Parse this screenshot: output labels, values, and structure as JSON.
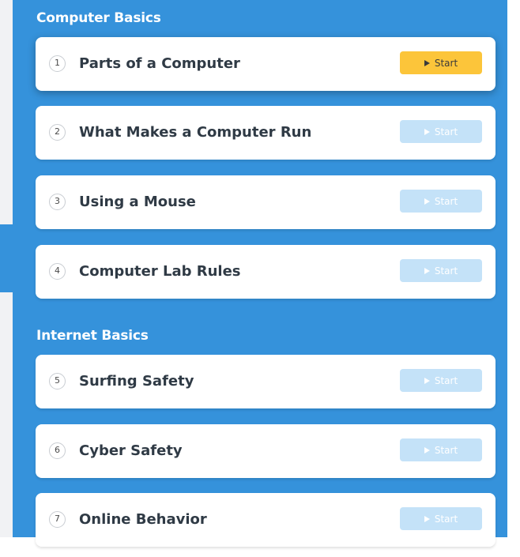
{
  "colors": {
    "panel_background": "#3592db",
    "card_background": "#ffffff",
    "start_active": "#fcc53a",
    "start_inactive": "#c4e2f8"
  },
  "sections": [
    {
      "title": "Computer Basics",
      "lessons": [
        {
          "number": "1",
          "title": "Parts of a Computer",
          "start_label": "Start",
          "state": "active"
        },
        {
          "number": "2",
          "title": "What Makes a Computer Run",
          "start_label": "Start",
          "state": "inactive"
        },
        {
          "number": "3",
          "title": "Using a Mouse",
          "start_label": "Start",
          "state": "inactive"
        },
        {
          "number": "4",
          "title": "Computer Lab Rules",
          "start_label": "Start",
          "state": "inactive"
        }
      ]
    },
    {
      "title": "Internet Basics",
      "lessons": [
        {
          "number": "5",
          "title": "Surfing Safety",
          "start_label": "Start",
          "state": "inactive"
        },
        {
          "number": "6",
          "title": "Cyber Safety",
          "start_label": "Start",
          "state": "inactive"
        },
        {
          "number": "7",
          "title": "Online Behavior",
          "start_label": "Start",
          "state": "inactive"
        }
      ]
    }
  ]
}
